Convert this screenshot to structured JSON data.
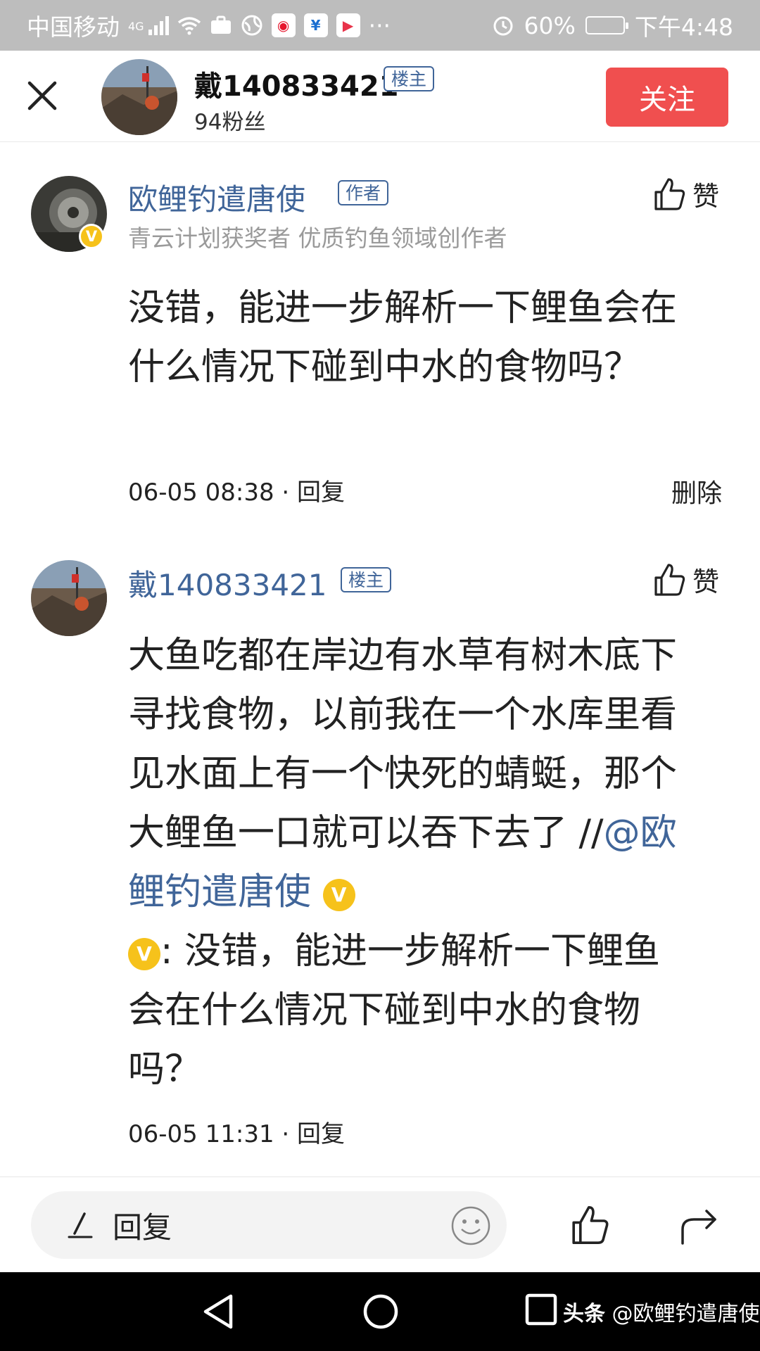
{
  "status_bar": {
    "carrier": "中国移动",
    "network": "4G",
    "battery": "60%",
    "battery_level": 0.6,
    "time": "下午4:48",
    "ellipsis": "···"
  },
  "header": {
    "name": "戴140833421",
    "badge": "楼主",
    "fans": "94粉丝",
    "follow_label": "关注"
  },
  "comments": [
    {
      "name": "欧鲤钓遣唐使",
      "tag": "作者",
      "subtitle": "青云计划获奖者 优质钓鱼领域创作者",
      "like_label": "赞",
      "text": "没错，能进一步解析一下鲤鱼会在什么情况下碰到中水的食物吗？",
      "meta": "06-05 08:38 · 回复",
      "delete_label": "删除"
    },
    {
      "name": "戴140833421",
      "tag": "楼主",
      "like_label": "赞",
      "text_main": "大鱼吃都在岸边有水草有树木底下寻找食物，以前我在一个水库里看见水面上有一个快死的蜻蜓，那个大鲤鱼一口就可以吞下去了 //",
      "mention": "@欧鲤钓遣唐使",
      "quote_line": ": 没错，能进一步解析一下鲤鱼",
      "quote_rest": "会在什么情况下碰到中水的食物吗？",
      "meta": "06-05 11:31 · 回复"
    }
  ],
  "bottom_bar": {
    "reply_placeholder": "回复"
  },
  "watermark": {
    "brand": "头条",
    "handle": "@欧鲤钓遣唐使"
  },
  "colors": {
    "accent_red": "#f04f4f",
    "link_blue": "#406599",
    "verified_yellow": "#f6c21b",
    "status_bar_gray": "#bdbdbd"
  }
}
